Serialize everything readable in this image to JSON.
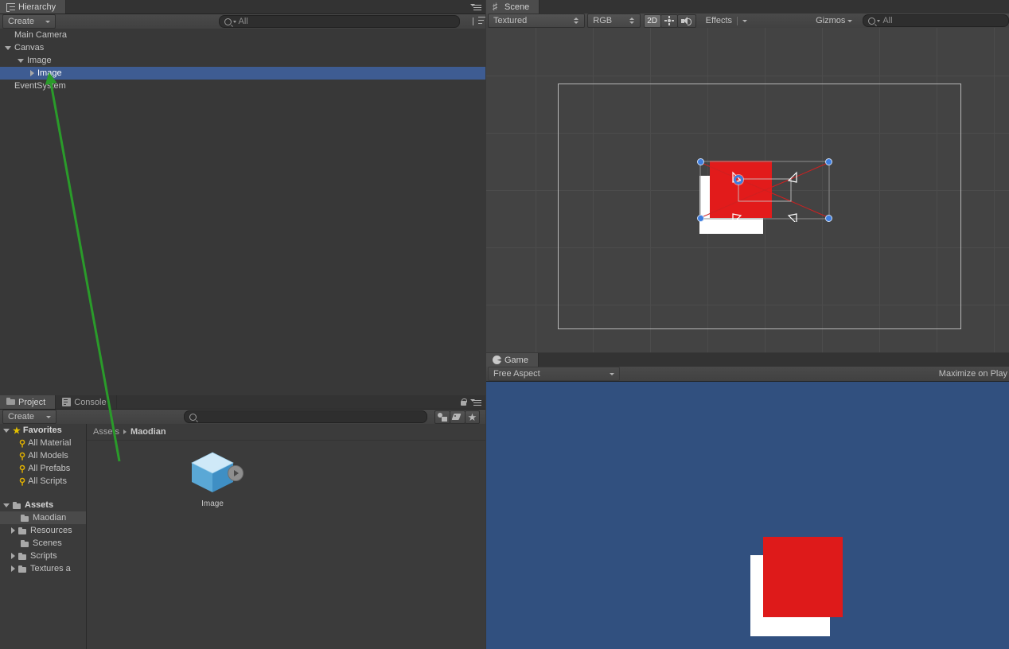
{
  "hierarchy": {
    "tab_label": "Hierarchy",
    "tab_icon": "hierarchy-list-icon",
    "create_label": "Create",
    "search_placeholder": "All",
    "menu_icon": "hamburger-menu-icon",
    "sort_icon": "alphabetical-sort-icon",
    "items": [
      {
        "label": "Main Camera",
        "depth": 0,
        "toggle": "none",
        "selected": false
      },
      {
        "label": "Canvas",
        "depth": 0,
        "toggle": "down",
        "selected": false
      },
      {
        "label": "Image",
        "depth": 1,
        "toggle": "down",
        "selected": false
      },
      {
        "label": "Image",
        "depth": 2,
        "toggle": "right",
        "selected": true
      },
      {
        "label": "EventSystem",
        "depth": 0,
        "toggle": "none",
        "selected": false
      }
    ]
  },
  "project": {
    "tabs": [
      {
        "label": "Project",
        "icon": "folder-icon",
        "active": true
      },
      {
        "label": "Console",
        "icon": "console-icon",
        "active": false
      }
    ],
    "create_label": "Create",
    "search_placeholder": "",
    "lock_icon": "lock-icon",
    "menu_icon": "hamburger-menu-icon",
    "toolbar_icons": [
      "filter-by-type-icon",
      "filter-by-label-icon",
      "favorite-star-icon"
    ],
    "favorites": {
      "header": "Favorites",
      "items": [
        "All Material",
        "All Models",
        "All Prefabs",
        "All Scripts"
      ]
    },
    "assets": {
      "header": "Assets",
      "items": [
        {
          "label": "Maodian",
          "expandable": false,
          "selected": true
        },
        {
          "label": "Resources",
          "expandable": true,
          "selected": false
        },
        {
          "label": "Scenes",
          "expandable": false,
          "selected": false
        },
        {
          "label": "Scripts",
          "expandable": true,
          "selected": false
        },
        {
          "label": "Textures a",
          "expandable": true,
          "selected": false
        }
      ]
    },
    "breadcrumb": {
      "root": "Assets",
      "current": "Maodian"
    },
    "asset_grid": [
      {
        "label": "Image",
        "icon": "prefab-cube-icon",
        "has_play_badge": true
      }
    ]
  },
  "scene": {
    "tab_label": "Scene",
    "tab_icon": "scene-grid-icon",
    "draw_mode": "Textured",
    "color_mode": "RGB",
    "mode_2d": "2D",
    "lighting_icon": "sun-lighting-icon",
    "audio_icon": "audio-mute-icon",
    "effects_label": "Effects",
    "gizmos_label": "Gizmos",
    "search_placeholder": "All",
    "canvas_color": "#b7b7b7",
    "grid_color": "#4c4c4c",
    "background_color": "#434343",
    "graphic": {
      "white_color": "#ffffff",
      "red_color": "#e21b1b"
    },
    "gizmo": {
      "handle_color": "#3e7ee0",
      "pivot_color": "#3e7ee0",
      "anchor_line_color": "#cf2020",
      "rect_line_color": "#8c8c8c"
    }
  },
  "game": {
    "tab_label": "Game",
    "tab_icon": "game-icon",
    "aspect_label": "Free Aspect",
    "maximize_label": "Maximize on Play",
    "background_color": "#31507f",
    "white_color": "#ffffff",
    "red_color": "#de1a1a"
  },
  "annotation": {
    "arrow_color": "#2a9b2a",
    "description": "green-arrow-from-asset-to-hierarchy-item"
  }
}
